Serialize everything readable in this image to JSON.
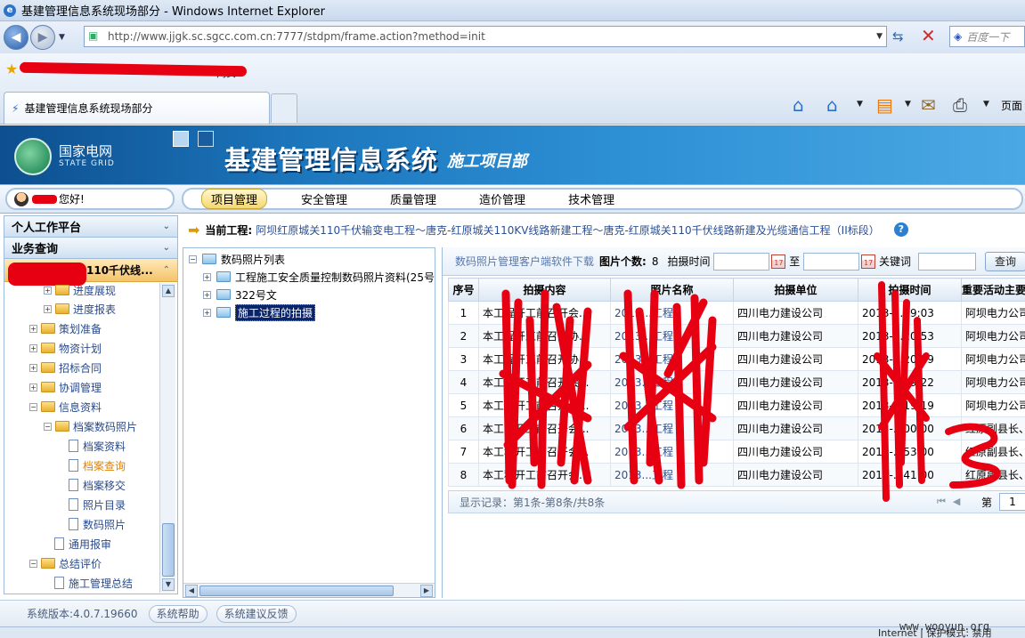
{
  "browser": {
    "window_title": "基建管理信息系统现场部分 - Windows Internet Explorer",
    "url": "http://www.jjgk.sc.sgcc.com.cn:7777/stdpm/frame.action?method=init",
    "search_placeholder": "百度一下",
    "favorites_label": "网页",
    "tab_title": "基建管理信息系统现场部分",
    "page_menu": "页面",
    "status_zone": "Internet | 保护模式: 禁用"
  },
  "banner": {
    "logo_cn": "国家电网",
    "logo_en": "STATE GRID",
    "system_name": "基建管理信息系统",
    "department": "施工项目部"
  },
  "user": {
    "greeting": "您好!"
  },
  "top_menu": [
    {
      "label": "项目管理",
      "active": true
    },
    {
      "label": "安全管理",
      "active": false
    },
    {
      "label": "质量管理",
      "active": false
    },
    {
      "label": "造价管理",
      "active": false
    },
    {
      "label": "技术管理",
      "active": false
    }
  ],
  "sidebar": {
    "section_personal": "个人工作平台",
    "section_query": "业务查询",
    "project_label": "110千伏线...",
    "tree": [
      {
        "label": "进度展现",
        "type": "folder"
      },
      {
        "label": "进度报表",
        "type": "folder"
      },
      {
        "label": "策划准备",
        "type": "folder"
      },
      {
        "label": "物资计划",
        "type": "folder"
      },
      {
        "label": "招标合同",
        "type": "folder"
      },
      {
        "label": "协调管理",
        "type": "folder"
      },
      {
        "label": "信息资料",
        "type": "folder"
      },
      {
        "label": "档案数码照片",
        "type": "folder"
      },
      {
        "label": "档案资料",
        "type": "doc"
      },
      {
        "label": "档案查询",
        "type": "doc",
        "selected": true
      },
      {
        "label": "档案移交",
        "type": "doc"
      },
      {
        "label": "照片目录",
        "type": "doc"
      },
      {
        "label": "数码照片",
        "type": "doc"
      },
      {
        "label": "通用报审",
        "type": "doc"
      },
      {
        "label": "总结评价",
        "type": "folder"
      },
      {
        "label": "施工管理总结",
        "type": "doc"
      }
    ]
  },
  "current_project": {
    "label": "当前工程:",
    "value": "阿坝红原城关110千伏输变电工程～唐克-红原城关110KV线路新建工程～唐克-红原城关110千伏线路新建及光缆通信工程（II标段）"
  },
  "photo_tree": {
    "root": "数码照片列表",
    "children": [
      "工程施工安全质量控制数码照片资料(25号",
      "322号文",
      "施工过程的拍摄"
    ]
  },
  "filter": {
    "download_link": "数码照片管理客户端软件下载",
    "count_label": "图片个数:",
    "count": "8",
    "time_label": "拍摄时间",
    "to_label": "至",
    "keyword_label": "关键词",
    "query_button": "查询"
  },
  "table": {
    "columns": [
      "序号",
      "拍摄内容",
      "照片名称",
      "拍摄单位",
      "拍摄时间",
      "重要活动主要"
    ],
    "rows": [
      [
        "1",
        "本工程开工前召开会...",
        "2013...工程",
        "四川电力建设公司",
        "2013-...09:03",
        "阿坝电力公司客"
      ],
      [
        "2",
        "本工程开工前召开协...",
        "2013...工程",
        "四川电力建设公司",
        "2013-...20:53",
        "阿坝电力公司客"
      ],
      [
        "3",
        "本工程开工前召开协...",
        "2013...工程",
        "四川电力建设公司",
        "2013-...20:29",
        "阿坝电力公司客"
      ],
      [
        "4",
        "本工程开工前召开会...",
        "2013...工程",
        "四川电力建设公司",
        "2013-...19:22",
        "阿坝电力公司客"
      ],
      [
        "5",
        "本工程开工前召开会...",
        "2013...工程",
        "四川电力建设公司",
        "2013-...19:19",
        "阿坝电力公司客"
      ],
      [
        "6",
        "本工程开工前召开会...",
        "2013...工程",
        "四川电力建设公司",
        "2013-...00:00",
        "红原副县长、"
      ],
      [
        "7",
        "本工程开工前召开会...",
        "2013...工程",
        "四川电力建设公司",
        "2013-...53:00",
        "红原副县长、"
      ],
      [
        "8",
        "本工程开工前召开会...",
        "2013...工程",
        "四川电力建设公司",
        "2013-...41:00",
        "红原副县长、"
      ]
    ]
  },
  "pager": {
    "summary": "显示记录：第1条-第8条/共8条",
    "page_label": "第",
    "page_value": "1"
  },
  "footer": {
    "version": "系统版本:4.0.7.19660",
    "help": "系统帮助",
    "feedback": "系统建议反馈"
  },
  "watermark": "www.wooyun.org",
  "colors": {
    "redaction": "#e60012",
    "banner": "#1d77bd",
    "active_menu": "#f4d874"
  }
}
